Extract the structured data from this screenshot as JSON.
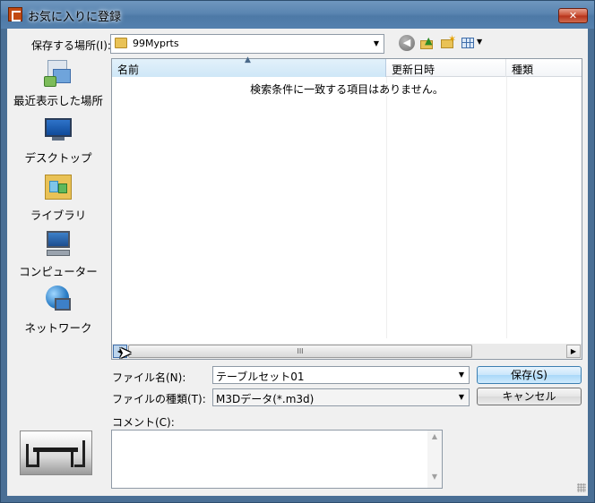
{
  "window": {
    "title": "お気に入りに登録",
    "close_label": "✕"
  },
  "save_in": {
    "label": "保存する場所(I):",
    "value": "99Myprts"
  },
  "toolbar": {
    "back_glyph": "◀"
  },
  "places": [
    {
      "label": "最近表示した場所"
    },
    {
      "label": "デスクトップ"
    },
    {
      "label": "ライブラリ"
    },
    {
      "label": "コンピューター"
    },
    {
      "label": "ネットワーク"
    }
  ],
  "file_list": {
    "columns": [
      "名前",
      "更新日時",
      "種類"
    ],
    "empty_message": "検索条件に一致する項目はありません。",
    "scroll_grip": "III"
  },
  "form": {
    "filename_label": "ファイル名(N):",
    "filename_value": "テーブルセット01",
    "filetype_label": "ファイルの種類(T):",
    "filetype_value": "M3Dデータ(*.m3d)",
    "comment_label": "コメント(C):",
    "comment_value": ""
  },
  "buttons": {
    "save": "保存(S)",
    "cancel": "キャンセル"
  },
  "colors": {
    "title_bar": "#5a85b1",
    "close": "#c84b2f",
    "client": "#f0f0f0",
    "column_header_active": "#cfe7f7"
  },
  "icons": [
    "app-icon",
    "close-icon",
    "folder-icon",
    "back-icon",
    "up-folder-icon",
    "new-folder-icon",
    "views-menu-icon",
    "recent-places-icon",
    "desktop-icon",
    "library-icon",
    "computer-icon",
    "network-icon"
  ]
}
